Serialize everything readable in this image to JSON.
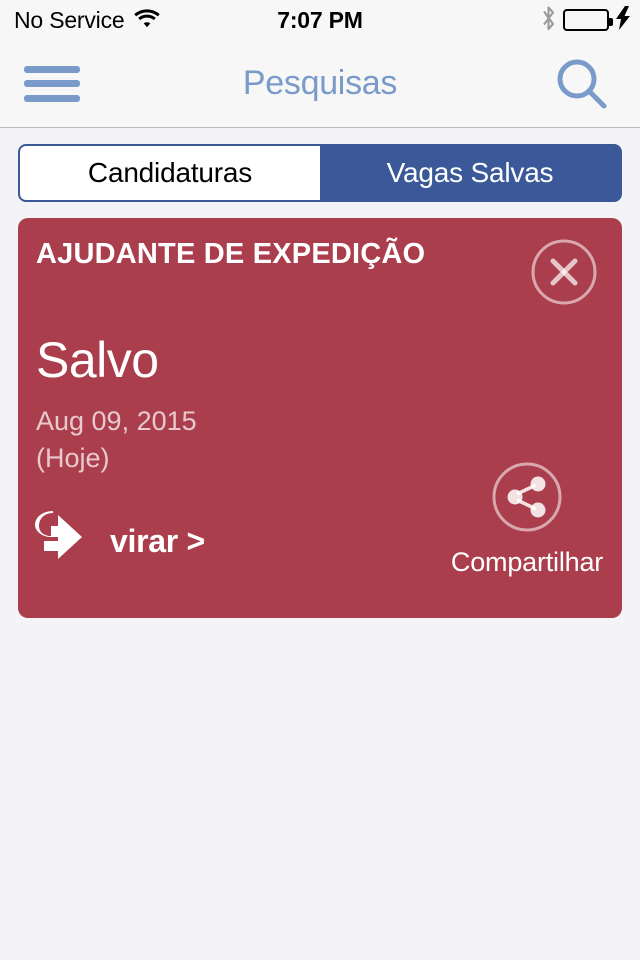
{
  "status_bar": {
    "carrier": "No Service",
    "wifi_icon": "wifi-icon",
    "time": "7:07 PM",
    "bluetooth_icon": "bluetooth-icon",
    "battery_icon": "battery-full-icon",
    "charging_icon": "charging-bolt-icon",
    "battery_color": "#34d64a"
  },
  "nav_bar": {
    "menu_icon": "hamburger-menu-icon",
    "title": "Pesquisas",
    "search_icon": "search-icon",
    "accent_color": "#7a9bc9",
    "background_color": "#f7f7f8"
  },
  "segmented_control": {
    "accent_color": "#3b5998",
    "segments": [
      {
        "label": "Candidaturas",
        "selected": false
      },
      {
        "label": "Vagas Salvas",
        "selected": true
      }
    ]
  },
  "card": {
    "background_color": "#ab3e4c",
    "title": "AJUDANTE DE EXPEDIÇÃO",
    "close_icon": "close-circle-icon",
    "status": "Salvo",
    "date": "Aug 09, 2015",
    "date_relative": "(Hoje)",
    "flip_icon": "flip-card-icon",
    "flip_label": "virar >",
    "share_icon": "share-circle-icon",
    "share_label": "Compartilhar"
  }
}
